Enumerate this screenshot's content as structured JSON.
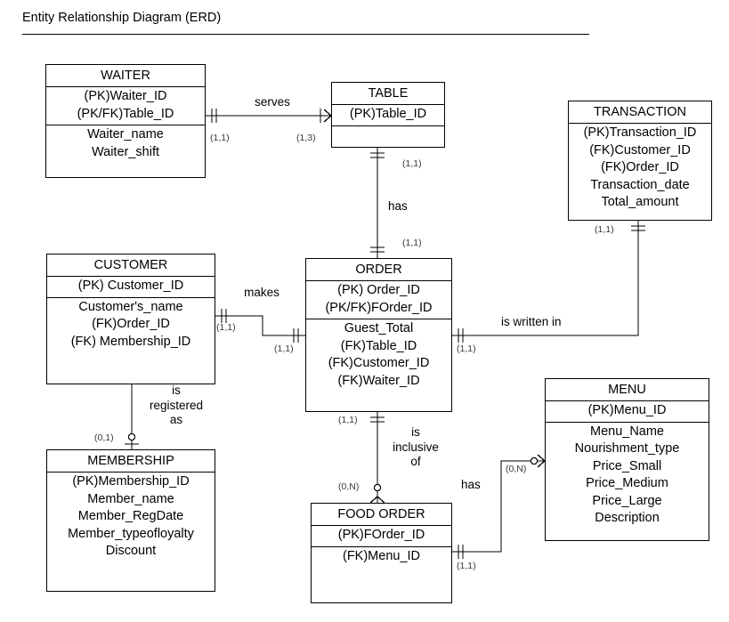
{
  "page": {
    "title": "Entity Relationship Diagram (ERD)"
  },
  "entities": {
    "waiter": {
      "name": "WAITER",
      "keys": "(PK)Waiter_ID\n(PK/FK)Table_ID",
      "attributes": "Waiter_name\nWaiter_shift"
    },
    "table": {
      "name": "TABLE",
      "keys": "(PK)Table_ID",
      "attributes": ""
    },
    "transaction": {
      "name": "TRANSACTION",
      "keys": "(PK)Transaction_ID\n(FK)Customer_ID\n(FK)Order_ID\nTransaction_date\nTotal_amount",
      "attributes": ""
    },
    "customer": {
      "name": "CUSTOMER",
      "keys": "(PK) Customer_ID",
      "attributes": "Customer's_name\n(FK)Order_ID\n(FK) Membership_ID"
    },
    "order": {
      "name": "ORDER",
      "keys": "(PK) Order_ID\n(PK/FK)FOrder_ID",
      "attributes": "Guest_Total\n(FK)Table_ID\n(FK)Customer_ID\n(FK)Waiter_ID"
    },
    "membership": {
      "name": "MEMBERSHIP",
      "keys": "",
      "attributes": "(PK)Membership_ID\nMember_name\nMember_RegDate\nMember_typeofloyalty\nDiscount"
    },
    "food_order": {
      "name": "FOOD ORDER",
      "keys": "(PK)FOrder_ID",
      "attributes": "(FK)Menu_ID"
    },
    "menu": {
      "name": "MENU",
      "keys": "(PK)Menu_ID",
      "attributes": "Menu_Name\nNourishment_type\nPrice_Small\nPrice_Medium\nPrice_Large\nDescription"
    }
  },
  "relationships": {
    "serves": {
      "label": "serves",
      "from_cardinality": "(1,1)",
      "to_cardinality": "(1,3)"
    },
    "table_has_order": {
      "label": "has",
      "from_cardinality": "(1,1)",
      "to_cardinality": "(1,1)"
    },
    "makes": {
      "label": "makes",
      "from_cardinality": "(1,1)",
      "to_cardinality": "(1,1)"
    },
    "is_written_in": {
      "label": "is written in",
      "from_cardinality": "(1,1)",
      "to_cardinality": "(1,1)"
    },
    "is_registered_as": {
      "label": "is\nregistered\nas",
      "from_cardinality": "(0,1)"
    },
    "is_inclusive_of": {
      "label": "is\ninclusive\nof",
      "from_cardinality": "(1,1)",
      "to_cardinality": "(0,N)"
    },
    "menu_has": {
      "label": "has",
      "from_cardinality": "(1,1)",
      "to_cardinality": "(0,N)"
    }
  },
  "colors": {
    "line": "#000000",
    "box_fill": "#ffffff",
    "text": "#000000",
    "cardinality_text": "#3a3a3a"
  }
}
